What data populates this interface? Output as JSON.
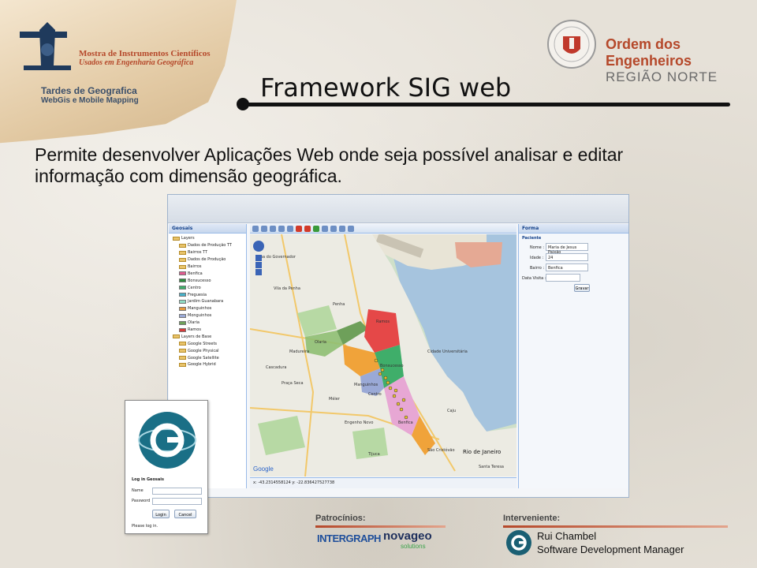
{
  "branding": {
    "left_logo_line1": "Mostra de Instrumentos Científicos",
    "left_logo_line2": "Usados em Engenharia Geográfica",
    "event_title": "Tardes de Geografica",
    "event_subtitle": "WebGis e Mobile Mapping",
    "org_line1": "Ordem dos Engenheiros",
    "org_line2": "REGIÃO NORTE",
    "accent_color": "#b5482a"
  },
  "slide": {
    "title": "Framework SIG web",
    "description": "Permite desenvolver Aplicações Web onde seja possível analisar e editar informação com dimensão geográfica."
  },
  "app": {
    "geosais_panel": {
      "header": "Geosais",
      "tree": [
        {
          "label": "Layers",
          "swatch": ""
        },
        {
          "label": "Dados de Produção TT",
          "swatch": ""
        },
        {
          "label": "Bairros TT",
          "swatch": ""
        },
        {
          "label": "Dados de Produção",
          "swatch": ""
        },
        {
          "label": "Bairros",
          "swatch": ""
        },
        {
          "label": "Benfica",
          "swatch": "#e05a8f"
        },
        {
          "label": "Bonsucesso",
          "swatch": "#2e8b3e"
        },
        {
          "label": "Centro",
          "swatch": "#3fae6a"
        },
        {
          "label": "Freguesia",
          "swatch": "#46b1c9"
        },
        {
          "label": "Jardim Guanabara",
          "swatch": "#8fdcc4"
        },
        {
          "label": "Manguinhos",
          "swatch": "#e79a3a"
        },
        {
          "label": "Monguinhos",
          "swatch": "#9aa9d6"
        },
        {
          "label": "Olaria",
          "swatch": "#6ea05a"
        },
        {
          "label": "Ramos",
          "swatch": "#d63b3b"
        },
        {
          "label": "Layers de Base",
          "swatch": ""
        },
        {
          "label": "Google Streets",
          "swatch": ""
        },
        {
          "label": "Google Physical",
          "swatch": ""
        },
        {
          "label": "Google Satellite",
          "swatch": ""
        },
        {
          "label": "Google Hybrid",
          "swatch": ""
        }
      ]
    },
    "map": {
      "labels": [
        "Benfica",
        "Olaria",
        "Ramos",
        "Bonsucesso",
        "Manguinhos",
        "Centro",
        "Rio de Janeiro",
        "Ilha do Governador",
        "Cidade Universitária",
        "Penha",
        "Vila da Penha",
        "Praça Seca",
        "Madureira",
        "Cascadura",
        "Méier",
        "Engenho Novo",
        "São Cristóvão",
        "Tijuca",
        "Santa Teresa",
        "Caju"
      ],
      "footer": "x: -43.2314558124  y: -22.836427527738",
      "google_label": "Google"
    },
    "forma_panel": {
      "header": "Forma",
      "section": "Paciente",
      "fields": [
        {
          "label": "Nome :",
          "value": "Maria de Jesus Paixão"
        },
        {
          "label": "Idade :",
          "value": "24"
        },
        {
          "label": "Bairro :",
          "value": "Benfica"
        },
        {
          "label": "Data Visita :",
          "value": ""
        }
      ],
      "button": "Gravar"
    }
  },
  "login": {
    "title": "Log in Geosais",
    "name_label": "Name",
    "password_label": "Password",
    "login_button": "Login",
    "cancel_button": "Cancel",
    "note": "Please log in."
  },
  "footer": {
    "patrocinios": "Patrocínios:",
    "interveniente": "Interveniente:",
    "sponsor1": "INTERGRAPH",
    "sponsor2": "novageo",
    "sponsor2_sub": "solutions",
    "presenter_name": "Rui Chambel",
    "presenter_role": "Software Development Manager"
  }
}
